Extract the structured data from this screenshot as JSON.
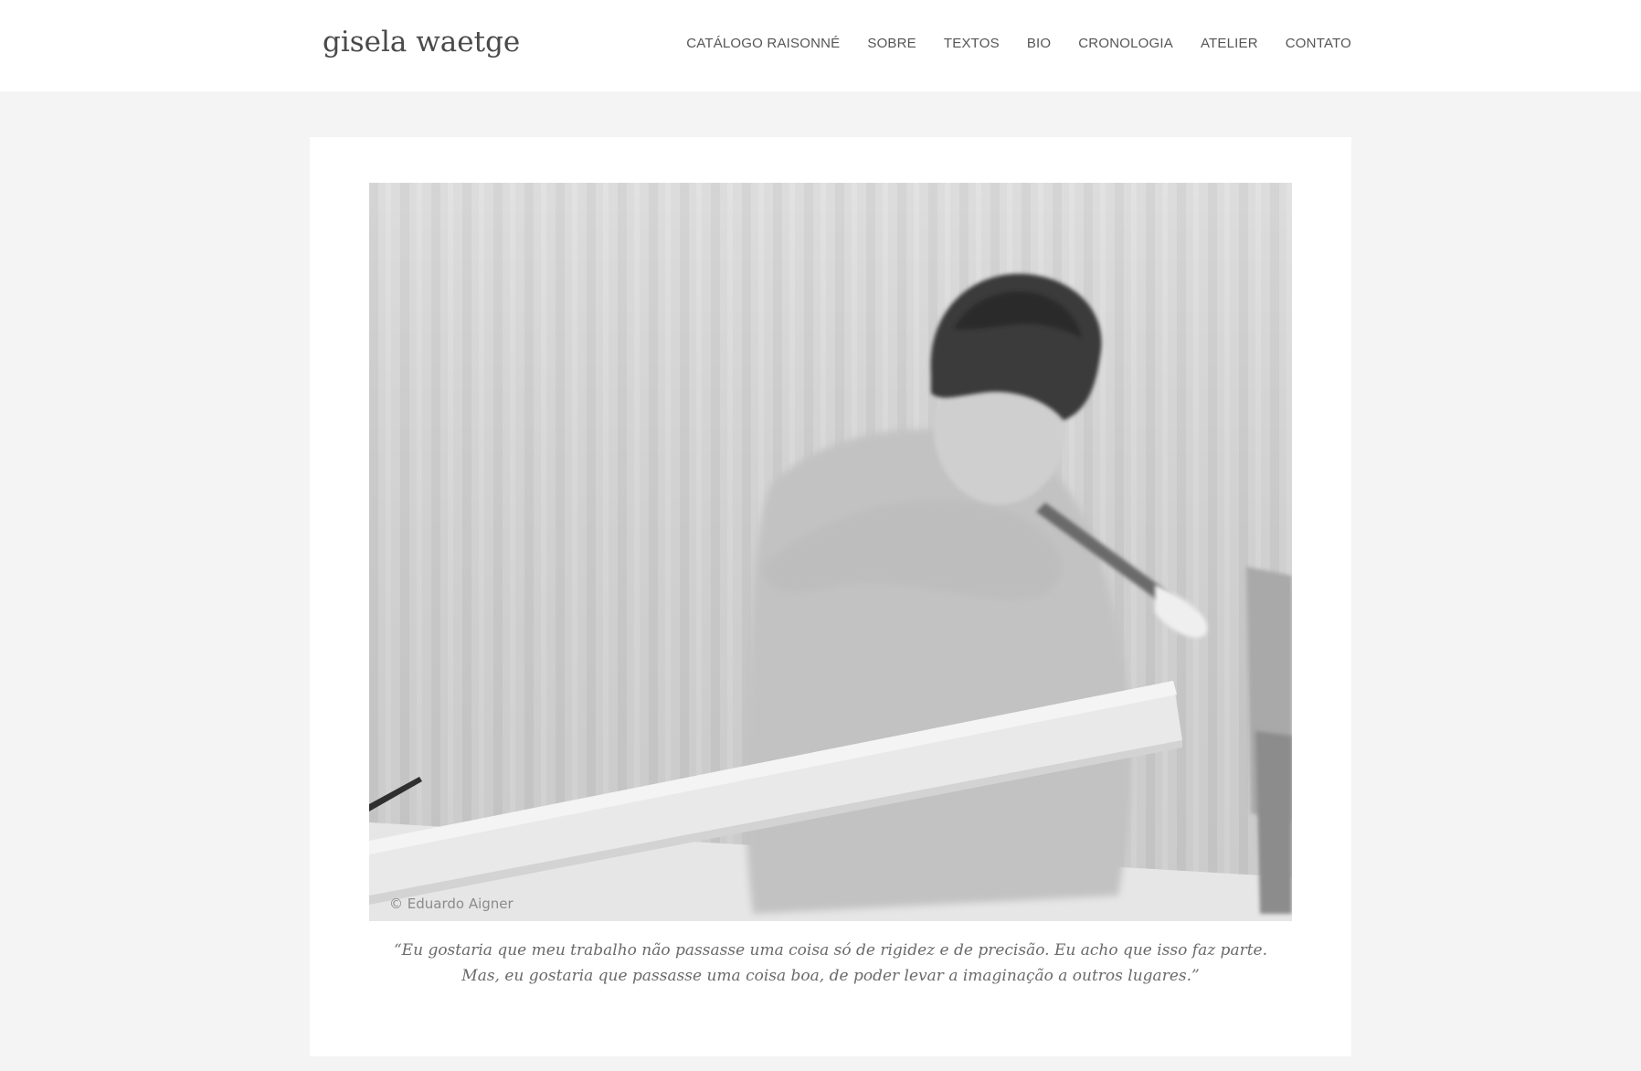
{
  "header": {
    "site_title": "gisela waetge",
    "nav": [
      {
        "label": "CATÁLOGO RAISONNÉ"
      },
      {
        "label": "SOBRE"
      },
      {
        "label": "TEXTOS"
      },
      {
        "label": "BIO"
      },
      {
        "label": "CRONOLOGIA"
      },
      {
        "label": "ATELIER"
      },
      {
        "label": "CONTATO"
      }
    ]
  },
  "main": {
    "photo": {
      "credit": "© Eduardo Aigner"
    },
    "quote": {
      "line1": "“Eu gostaria que meu trabalho não passasse uma coisa só de rigidez e de precisão. Eu acho que isso faz parte.",
      "line2": "Mas, eu gostaria que passasse uma coisa boa, de poder levar a imaginação a outros lugares.”"
    }
  }
}
